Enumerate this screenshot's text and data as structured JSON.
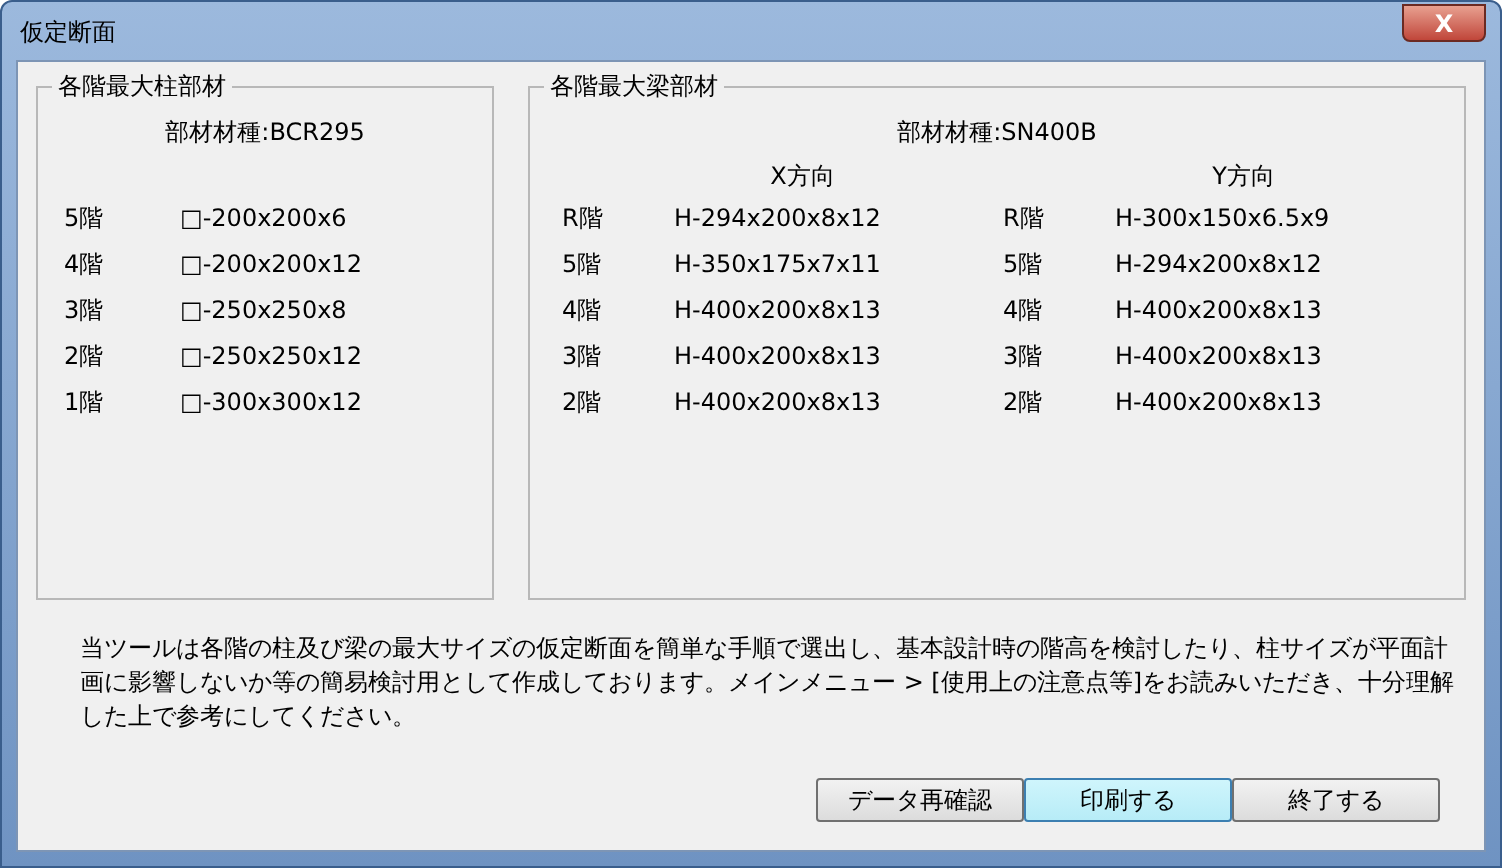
{
  "window": {
    "title": "仮定断面",
    "close": "X"
  },
  "columns_group": {
    "title": "各階最大柱部材",
    "material": "部材材種:BCR295",
    "rows": [
      {
        "floor": "5階",
        "section": "□-200x200x6"
      },
      {
        "floor": "4階",
        "section": "□-200x200x12"
      },
      {
        "floor": "3階",
        "section": "□-250x250x8"
      },
      {
        "floor": "2階",
        "section": "□-250x250x12"
      },
      {
        "floor": "1階",
        "section": "□-300x300x12"
      }
    ]
  },
  "beams_group": {
    "title": "各階最大梁部材",
    "material": "部材材種:SN400B",
    "directions": [
      {
        "heading": "X方向",
        "rows": [
          {
            "floor": "R階",
            "section": "H-294x200x8x12"
          },
          {
            "floor": "5階",
            "section": "H-350x175x7x11"
          },
          {
            "floor": "4階",
            "section": "H-400x200x8x13"
          },
          {
            "floor": "3階",
            "section": "H-400x200x8x13"
          },
          {
            "floor": "2階",
            "section": "H-400x200x8x13"
          }
        ]
      },
      {
        "heading": "Y方向",
        "rows": [
          {
            "floor": "R階",
            "section": "H-300x150x6.5x9"
          },
          {
            "floor": "5階",
            "section": "H-294x200x8x12"
          },
          {
            "floor": "4階",
            "section": "H-400x200x8x13"
          },
          {
            "floor": "3階",
            "section": "H-400x200x8x13"
          },
          {
            "floor": "2階",
            "section": "H-400x200x8x13"
          }
        ]
      }
    ]
  },
  "notice": "当ツールは各階の柱及び梁の最大サイズの仮定断面を簡単な手順で選出し、基本設計時の階高を検討したり、柱サイズが平面計画に影響しないか等の簡易検討用として作成しております。メインメニュー > [使用上の注意点等]をお読みいただき、十分理解した上で参考にしてください。",
  "buttons": [
    {
      "label": "データ再確認",
      "hovered": false
    },
    {
      "label": "印刷する",
      "hovered": true
    },
    {
      "label": "終了する",
      "hovered": false
    }
  ]
}
